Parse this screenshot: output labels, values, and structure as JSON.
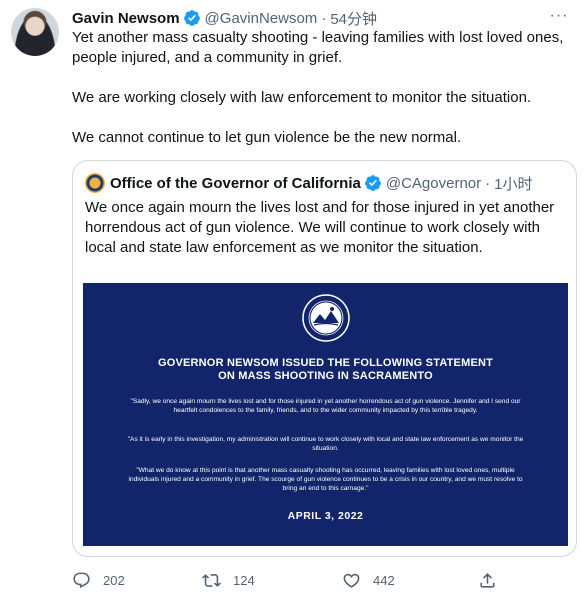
{
  "tweet": {
    "author_name": "Gavin Newsom",
    "handle": "@GavinNewsom",
    "separator": "·",
    "time": "54分钟",
    "more_label": "···",
    "paragraphs": [
      "Yet another mass casualty shooting - leaving families with lost loved ones, people injured, and a community in grief.",
      "We are working closely with law enforcement to monitor the situation.",
      "We cannot continue to let gun violence be the new normal."
    ]
  },
  "quote": {
    "author_name": "Office of the Governor of California",
    "handle": "@CAgovernor",
    "separator": "·",
    "time": "1小时",
    "text": "We once again mourn the lives lost and for those injured in yet another horrendous act of gun violence. We will continue to work closely with local and state law enforcement as we monitor the situation.",
    "statement": {
      "title_line1": "GOVERNOR NEWSOM ISSUED THE FOLLOWING STATEMENT",
      "title_line2": "ON MASS SHOOTING IN SACRAMENTO",
      "paragraph1": "\"Sadly, we once again mourn the lives lost and for those injured in yet another horrendous act of gun violence. Jennifer and I send our heartfelt condolences to the family, friends, and to the wider community impacted by this terrible tragedy.",
      "paragraph2": "\"As it is early in this investigation, my administration will continue to work closely with local and state law enforcement as we monitor the situation.",
      "paragraph3": "\"What we do know at this point is that another mass casualty shooting has occurred, leaving families with lost loved ones, multiple individuals injured and a community in grief. The scourge of gun violence continues to be a crisis in our country, and we must resolve to bring an end to this carnage.\"",
      "date": "APRIL 3, 2022"
    }
  },
  "actions": {
    "replies": "202",
    "retweets": "124",
    "likes": "442"
  },
  "colors": {
    "verified": "#1d9bf0",
    "statement_bg": "#12256a",
    "muted_text": "#536471",
    "border": "#cfd9de"
  },
  "icons": {
    "reply": "reply-icon",
    "retweet": "retweet-icon",
    "like": "heart-icon",
    "share": "share-icon",
    "verified": "verified-badge-icon"
  }
}
